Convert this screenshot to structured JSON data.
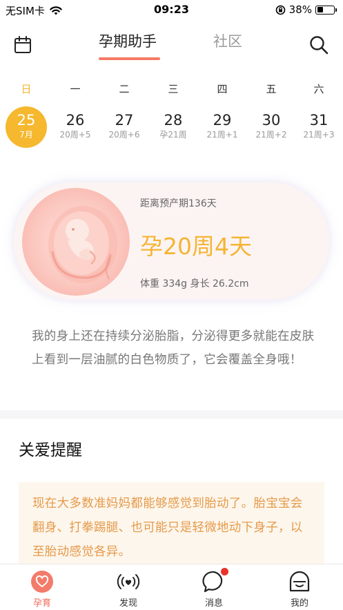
{
  "status_bar": {
    "carrier": "无SIM卡",
    "time": "09:23",
    "battery_percent": "38%",
    "battery_level": 0.38
  },
  "top_nav": {
    "tabs": [
      {
        "label": "孕期助手",
        "active": true
      },
      {
        "label": "社区",
        "active": false
      }
    ],
    "accent_color": "#f47a66"
  },
  "week": {
    "weekdays": [
      "日",
      "一",
      "二",
      "三",
      "四",
      "五",
      "六"
    ],
    "dates": [
      {
        "day": "25",
        "sub": "7月",
        "active": true
      },
      {
        "day": "26",
        "sub": "20周+5",
        "active": false
      },
      {
        "day": "27",
        "sub": "20周+6",
        "active": false
      },
      {
        "day": "28",
        "sub": "孕21周",
        "active": false
      },
      {
        "day": "29",
        "sub": "21周+1",
        "active": false
      },
      {
        "day": "30",
        "sub": "21周+2",
        "active": false
      },
      {
        "day": "31",
        "sub": "21周+3",
        "active": false
      }
    ],
    "active_color": "#f5b82e"
  },
  "pregnancy": {
    "due_text": "距离预产期136天",
    "week_text": "孕20周4天",
    "measure_text": "体重  334g  身长  26.2cm"
  },
  "description": "我的身上还在持续分泌胎脂，分泌得更多就能在皮肤上看到一层油腻的白色物质了，它会覆盖全身哦！",
  "care": {
    "title": "关爱提醒",
    "text": "现在大多数准妈妈都能够感觉到胎动了。胎宝宝会翻身、打拳踢腿、也可能只是轻微地动下身子，以至胎动感觉各异。"
  },
  "bottom_nav": {
    "items": [
      {
        "label": "孕育",
        "icon": "heart-icon",
        "active": true
      },
      {
        "label": "发现",
        "icon": "broadcast-icon",
        "active": false
      },
      {
        "label": "消息",
        "icon": "chat-bubble-icon",
        "active": false,
        "badge": true
      },
      {
        "label": "我的",
        "icon": "profile-icon",
        "active": false
      }
    ]
  }
}
